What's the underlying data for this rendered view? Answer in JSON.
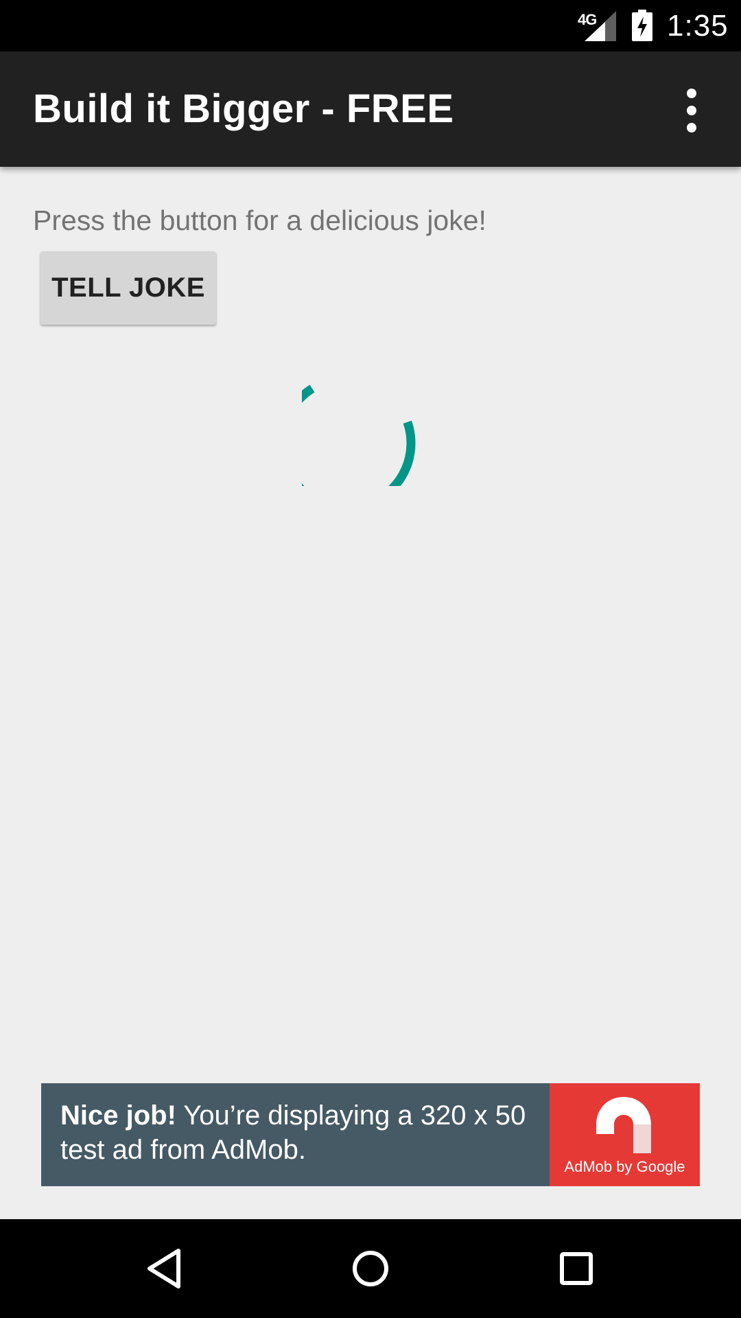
{
  "status_bar": {
    "network": "4G",
    "time": "1:35",
    "icons": [
      "signal-icon",
      "battery-charging-icon"
    ]
  },
  "app_bar": {
    "title": "Build it Bigger - FREE",
    "menu_icon": "more-vert-icon"
  },
  "main": {
    "prompt": "Press the button for a delicious joke!",
    "tell_joke_label": "TELL JOKE",
    "loading_indicator": "progress-spinner",
    "accent_color": "#009688"
  },
  "ad": {
    "headline": "Nice job!",
    "body": " You’re displaying a 320 x 50 test ad from AdMob.",
    "brand": "AdMob by Google",
    "background_color": "#455a64",
    "brand_color": "#e53935"
  },
  "nav_bar": {
    "icons": [
      "back-icon",
      "home-icon",
      "recents-icon"
    ]
  },
  "colors": {
    "status_bar": "#000000",
    "app_bar": "#212121",
    "background": "#eeeeee",
    "button": "#d6d6d6"
  }
}
